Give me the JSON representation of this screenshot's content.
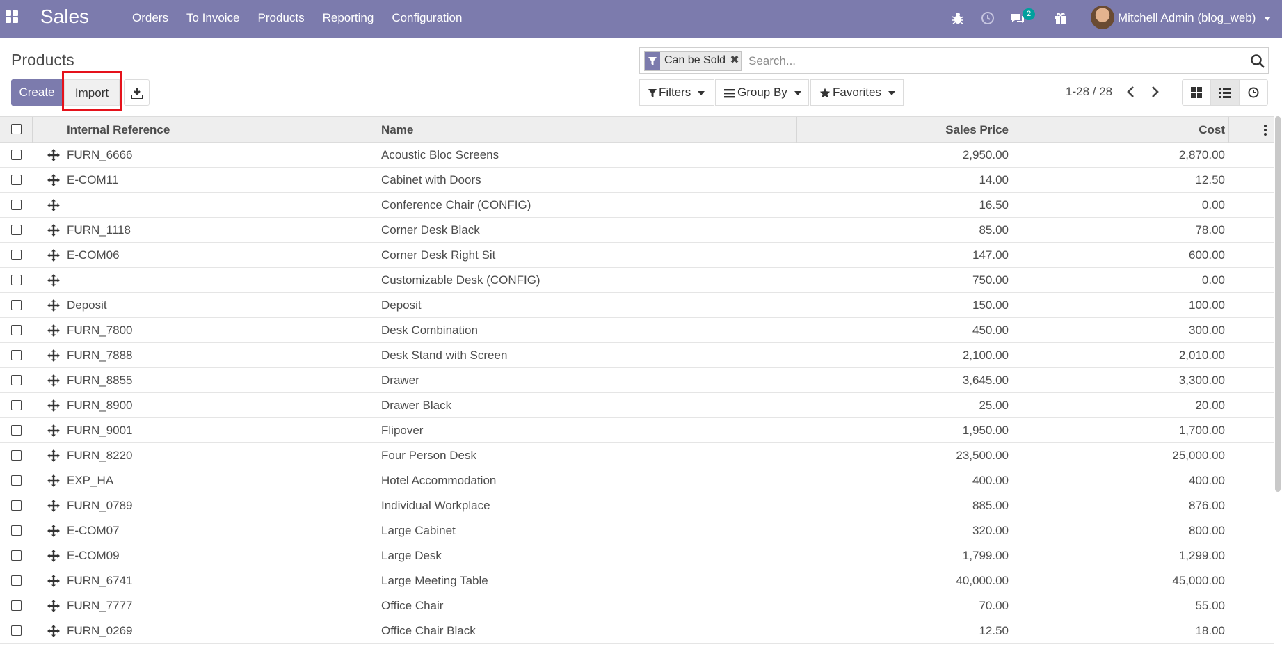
{
  "app": {
    "name": "Sales",
    "menu": [
      "Orders",
      "To Invoice",
      "Products",
      "Reporting",
      "Configuration"
    ],
    "messages_count": "2",
    "user_name": "Mitchell Admin (blog_web)"
  },
  "control": {
    "breadcrumb": "Products",
    "create_label": "Create",
    "import_label": "Import",
    "filters_label": "Filters",
    "groupby_label": "Group By",
    "favorites_label": "Favorites",
    "pager": "1-28 / 28",
    "active_view": "list"
  },
  "search": {
    "facet": "Can be Sold",
    "placeholder": "Search..."
  },
  "table": {
    "columns": [
      "Internal Reference",
      "Name",
      "Sales Price",
      "Cost"
    ],
    "rows": [
      {
        "ref": "FURN_6666",
        "name": "Acoustic Bloc Screens",
        "price": "2,950.00",
        "cost": "2,870.00"
      },
      {
        "ref": "E-COM11",
        "name": "Cabinet with Doors",
        "price": "14.00",
        "cost": "12.50"
      },
      {
        "ref": "",
        "name": "Conference Chair (CONFIG)",
        "price": "16.50",
        "cost": "0.00"
      },
      {
        "ref": "FURN_1118",
        "name": "Corner Desk Black",
        "price": "85.00",
        "cost": "78.00"
      },
      {
        "ref": "E-COM06",
        "name": "Corner Desk Right Sit",
        "price": "147.00",
        "cost": "600.00"
      },
      {
        "ref": "",
        "name": "Customizable Desk (CONFIG)",
        "price": "750.00",
        "cost": "0.00"
      },
      {
        "ref": "Deposit",
        "name": "Deposit",
        "price": "150.00",
        "cost": "100.00"
      },
      {
        "ref": "FURN_7800",
        "name": "Desk Combination",
        "price": "450.00",
        "cost": "300.00"
      },
      {
        "ref": "FURN_7888",
        "name": "Desk Stand with Screen",
        "price": "2,100.00",
        "cost": "2,010.00"
      },
      {
        "ref": "FURN_8855",
        "name": "Drawer",
        "price": "3,645.00",
        "cost": "3,300.00"
      },
      {
        "ref": "FURN_8900",
        "name": "Drawer Black",
        "price": "25.00",
        "cost": "20.00"
      },
      {
        "ref": "FURN_9001",
        "name": "Flipover",
        "price": "1,950.00",
        "cost": "1,700.00"
      },
      {
        "ref": "FURN_8220",
        "name": "Four Person Desk",
        "price": "23,500.00",
        "cost": "25,000.00"
      },
      {
        "ref": "EXP_HA",
        "name": "Hotel Accommodation",
        "price": "400.00",
        "cost": "400.00"
      },
      {
        "ref": "FURN_0789",
        "name": "Individual Workplace",
        "price": "885.00",
        "cost": "876.00"
      },
      {
        "ref": "E-COM07",
        "name": "Large Cabinet",
        "price": "320.00",
        "cost": "800.00"
      },
      {
        "ref": "E-COM09",
        "name": "Large Desk",
        "price": "1,799.00",
        "cost": "1,299.00"
      },
      {
        "ref": "FURN_6741",
        "name": "Large Meeting Table",
        "price": "40,000.00",
        "cost": "45,000.00"
      },
      {
        "ref": "FURN_7777",
        "name": "Office Chair",
        "price": "70.00",
        "cost": "55.00"
      },
      {
        "ref": "FURN_0269",
        "name": "Office Chair Black",
        "price": "12.50",
        "cost": "18.00"
      }
    ]
  },
  "colors": {
    "brand": "#7c7bad",
    "badge": "#00a09d",
    "highlight": "#e5121b"
  },
  "icons": [
    "apps-icon",
    "bug-icon",
    "clock-icon",
    "chat-icon",
    "gift-icon",
    "download-icon",
    "filter-icon",
    "search-icon",
    "drag-handle-icon",
    "kanban-view-icon",
    "list-view-icon",
    "activity-view-icon"
  ]
}
